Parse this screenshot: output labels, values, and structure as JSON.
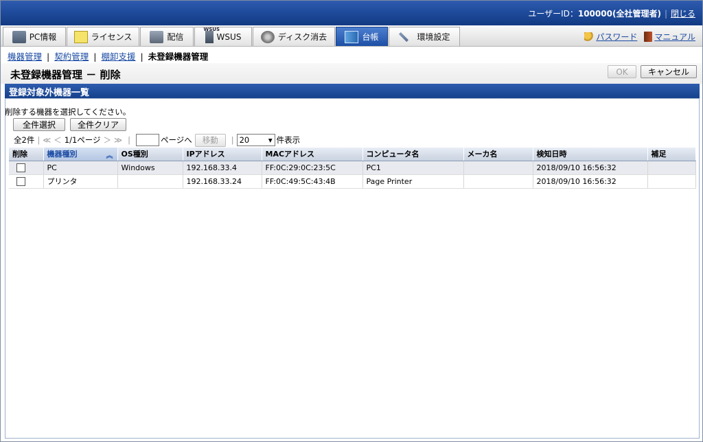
{
  "header": {
    "user_label": "ユーザーID：",
    "user_id": "100000(全社管理者)",
    "close_link": "閉じる"
  },
  "tabs": [
    {
      "label": "PC情報",
      "icon": "pc-icon"
    },
    {
      "label": "ライセンス",
      "icon": "license-icon"
    },
    {
      "label": "配信",
      "icon": "delivery-icon"
    },
    {
      "label": "WSUS",
      "icon": "wsus-icon",
      "superscript": "WSUS"
    },
    {
      "label": "ディスク消去",
      "icon": "disk-erase-icon"
    },
    {
      "label": "台帳",
      "icon": "ledger-icon",
      "active": true
    },
    {
      "label": "環境設定",
      "icon": "settings-tools-icon"
    }
  ],
  "top_links": {
    "password": "パスワード",
    "manual": "マニュアル"
  },
  "breadcrumb": {
    "items": [
      "機器管理",
      "契約管理",
      "棚卸支援"
    ],
    "current": "未登録機器管理"
  },
  "page": {
    "title": "未登録機器管理 － 削除",
    "ok_button": "OK",
    "cancel_button": "キャンセル"
  },
  "section": {
    "title": "登録対象外機器一覧",
    "instruction": "削除する機器を選択してください。",
    "select_all_button": "全件選択",
    "clear_all_button": "全件クリア"
  },
  "pager": {
    "total": "全2件",
    "nav_first": "≪",
    "nav_prev": "＜",
    "page_info": "1/1ページ",
    "nav_next": "＞",
    "nav_last": "≫",
    "page_input_value": "",
    "page_suffix": "ページへ",
    "move_button": "移動",
    "per_page_value": "20",
    "per_page_suffix": "件表示"
  },
  "table": {
    "columns": [
      "削除",
      "機器種別",
      "OS種別",
      "IPアドレス",
      "MACアドレス",
      "コンピュータ名",
      "メーカ名",
      "検知日時",
      "補足"
    ],
    "sorted_column": "機器種別",
    "rows": [
      {
        "checked": false,
        "device_type": "PC",
        "os": "Windows",
        "ip": "192.168.33.4",
        "mac": "FF:0C:29:0C:23:5C",
        "computer_name": "PC1",
        "maker": "",
        "detected": "2018/09/10 16:56:32",
        "note": ""
      },
      {
        "checked": false,
        "device_type": "プリンタ",
        "os": "",
        "ip": "192.168.33.24",
        "mac": "FF:0C:49:5C:43:4B",
        "computer_name": "Page Printer",
        "maker": "",
        "detected": "2018/09/10 16:56:32",
        "note": ""
      }
    ]
  },
  "colors": {
    "header_blue": "#1e4a9a",
    "active_tab": "#2f62b8",
    "link": "#1a4aa3"
  }
}
